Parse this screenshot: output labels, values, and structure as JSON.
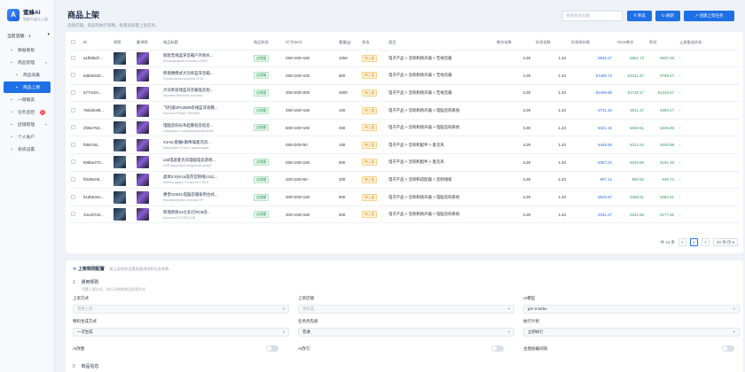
{
  "app": {
    "name": "蜜蜂AI",
    "subtitle": "智能开展元上架",
    "shop_label": "当前店铺：",
    "shop_value": "1",
    "nav": [
      {
        "label": "数据看板",
        "icon": "dashboard-icon",
        "active": false,
        "caret": false,
        "sub": false,
        "badge": ""
      },
      {
        "label": "商品管理",
        "icon": "box-icon",
        "active": false,
        "caret": true,
        "sub": false,
        "badge": ""
      },
      {
        "label": "商品采集",
        "icon": "download-icon",
        "active": false,
        "caret": false,
        "sub": true,
        "badge": ""
      },
      {
        "label": "商品上架",
        "icon": "upload-icon",
        "active": true,
        "caret": false,
        "sub": true,
        "badge": ""
      },
      {
        "label": "一键跟卖",
        "icon": "flash-icon",
        "active": false,
        "caret": false,
        "sub": false,
        "badge": ""
      },
      {
        "label": "任务监控",
        "icon": "monitor-icon",
        "active": false,
        "caret": false,
        "sub": false,
        "badge": "1"
      },
      {
        "label": "店铺管理",
        "icon": "store-icon",
        "active": false,
        "caret": true,
        "sub": false,
        "badge": ""
      },
      {
        "label": "个人账户",
        "icon": "user-icon",
        "active": false,
        "caret": false,
        "sub": false,
        "badge": ""
      },
      {
        "label": "系统设置",
        "icon": "gear-icon",
        "active": false,
        "caret": false,
        "sub": false,
        "badge": ""
      }
    ]
  },
  "page": {
    "title": "商品上架",
    "desc": "选择店铺、商品和执行策略，批量高质量上架任务。",
    "search_placeholder": "搜索商品标题",
    "btn_filter": "筛选",
    "btn_refresh": "刷新",
    "btn_create": "创建上架任务"
  },
  "table": {
    "headers": [
      "",
      "ID",
      "原图",
      "翻译图",
      "商品标题",
      "商品状态",
      "尺寸(mm)",
      "重量(g)",
      "状态",
      "类目",
      "售价倍数",
      "折扣倍数",
      "折扣前价格",
      "Ozon售价",
      "利润",
      "上架推送状态"
    ],
    "rows": [
      {
        "id": "a1fb5bd7...",
        "t1": "新款无线蓝牙音箱户外防水...",
        "t2": "Беспроводная колонка с RGB",
        "state": "店铺屋",
        "size": "250×150×150",
        "weight": "1050",
        "status": "待上架",
        "cat": "电子产品 > 音响和扬声器 > 无线音箱",
        "m1": "4.29",
        "m2": "1.43",
        "p1": "¥946.27",
        "p2": "¥661.73",
        "profit": "¥507.48",
        "push": "-"
      },
      {
        "id": "6db5e530...",
        "t1": "跨境便携式大功率蓝牙音箱...",
        "t2": "Портативная колонка 20 Вт",
        "state": "店铺屋",
        "size": "250×100×100",
        "weight": "800",
        "status": "待上架",
        "cat": "电子产品 > 音响和扬声器 > 无线音箱",
        "m1": "4.29",
        "m2": "1.43",
        "p1": "¥1490.73",
        "p2": "¥1042.47",
        "profit": "¥799.47",
        "push": "-"
      },
      {
        "id": "6774cb4...",
        "t1": "大功率游戏蓝牙音箱低音炮...",
        "t2": "Игровая Bluetooth колонка",
        "state": "店铺屋",
        "size": "300×200×200",
        "weight": "4500",
        "status": "待上架",
        "cat": "电子产品 > 音响和扬声器 > 无线音箱",
        "m1": "4.29",
        "m2": "1.43",
        "p1": "¥2499.88",
        "p2": "¥1748.17",
        "profit": "¥1340.67",
        "push": "-"
      },
      {
        "id": "760d3c88...",
        "t1": "飞利浦SPA3809有线蓝牙双模...",
        "t2": "Колонки Philips SPA3809",
        "state": "店铺屋",
        "size": "450×150×150",
        "weight": "100",
        "status": "待上架",
        "cat": "电子产品 > 音响和扬声器 > 电脑音响系统",
        "m1": "4.29",
        "m2": "1.43",
        "p1": "¥731.26",
        "p2": "¥511.37",
        "profit": "¥392.17",
        "push": "-"
      },
      {
        "id": "4f36e754...",
        "t1": "电脑音响长条超重低音低音...",
        "t2": "Саундбар с сабвуфером Bluetooth",
        "state": "店铺屋",
        "size": "500×100×100",
        "weight": "450",
        "status": "待上架",
        "cat": "电子产品 > 音响和扬声器 > 电脑音响系统",
        "m1": "4.29",
        "m2": "1.43",
        "p1": "¥421.15",
        "p2": "¥294.51",
        "profit": "¥225.86",
        "push": "-"
      },
      {
        "id": "f6567a5...",
        "t1": "X1mic直播K歌降噪麦克风...",
        "t2": "Микрофон X1mic с шумоподав...",
        "state": "",
        "size": "250×200×50",
        "weight": "150",
        "status": "待上架",
        "cat": "电子产品 > 音响和配件 > 麦克风",
        "m1": "4.29",
        "m2": "1.43",
        "p1": "¥449.36",
        "p2": "¥314.24",
        "profit": "¥240.99",
        "push": "-"
      },
      {
        "id": "608be470...",
        "t1": "usb电容麦克风电脑电竞游戏...",
        "t2": "USB-микрофон конденсаторный",
        "state": "店铺屋",
        "size": "250×150×150",
        "weight": "600",
        "status": "待上架",
        "cat": "电子产品 > 音响和配件 > 麦克风",
        "m1": "4.29",
        "m2": "1.43",
        "p1": "¥357.04",
        "p2": "¥249.68",
        "profit": "¥191.48",
        "push": "-"
      },
      {
        "id": "f6185c09...",
        "t1": "晶体3.5分rca莲花音频线3.5公...",
        "t2": "Кабель аудио 3.5 мм на 2 RCA",
        "state": "店铺屋",
        "size": "200×150×50",
        "weight": "200",
        "status": "待上架",
        "cat": "电子产品 > 音响和适配器 > 音频线缆",
        "m1": "4.29",
        "m2": "1.43",
        "p1": "¥87.12",
        "p2": "¥60.92",
        "profit": "¥46.72",
        "push": "-"
      },
      {
        "id": "51d553ee...",
        "t1": "惠普G004C电脑音箱家用台式...",
        "t2": "Компьютерные колонки HP",
        "state": "店铺屋",
        "size": "300×200×150",
        "weight": "800",
        "status": "待上架",
        "cat": "电子产品 > 音响和扬声器 > 电脑音响系统",
        "m1": "4.29",
        "m2": "1.43",
        "p1": "¥526.97",
        "p2": "¥368.51",
        "profit": "¥282.61",
        "push": "-"
      },
      {
        "id": "34cd47d4...",
        "t1": "跨境新款X2七彩灯RGB音...",
        "t2": "Колонки X2 RGB USB",
        "state": "店铺屋",
        "size": "300×150×150",
        "weight": "600",
        "status": "待上架",
        "cat": "电子产品 > 音响和扬声器 > 电脑音响系统",
        "m1": "4.29",
        "m2": "1.43",
        "p1": "¥331.27",
        "p2": "¥231.66",
        "profit": "¥177.66",
        "push": "-"
      }
    ]
  },
  "pager": {
    "total": "共 10 条",
    "prev": "<",
    "current": "1",
    "next": ">",
    "size": "20 条/页"
  },
  "config": {
    "title": "上架规则配置",
    "subtitle": "按上架规则设置批量规则和任务参数",
    "step1_num": "1",
    "step1_title": "通用规则",
    "step1_desc": "设置上架方式、执行计划和商品处理方式",
    "f_mode_label": "上架方式",
    "f_mode_value": "直接上架",
    "f_store_label": "上架店铺",
    "f_store_value": "请先选...",
    "f_model_label": "AI模型",
    "f_model_value": "gm-3-turbo",
    "f_variant_label": "物料生成方式",
    "f_variant_value": "一次生成",
    "f_priority_label": "任务优先级",
    "f_priority_value": "普通",
    "f_plan_label": "执行计划",
    "f_plan_value": "立即执行",
    "t_ai_label": "AI改图",
    "t_rewrite_label": "AI改写",
    "t_stock_label": "主图加载间隔",
    "step2_num": "2",
    "step2_title": "商品信息"
  }
}
